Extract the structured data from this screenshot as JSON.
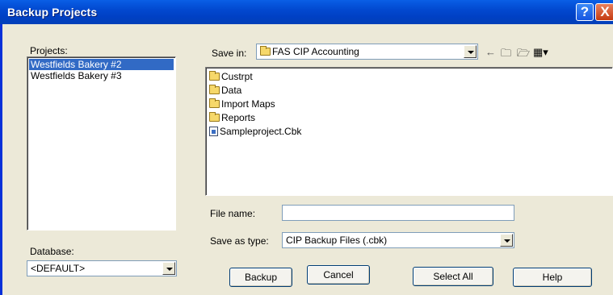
{
  "window": {
    "title": "Backup Projects",
    "help_glyph": "?",
    "close_glyph": "X"
  },
  "projects": {
    "label": "Projects:",
    "items": [
      {
        "label": "Westfields Bakery #2",
        "selected": true
      },
      {
        "label": "Westfields Bakery #3",
        "selected": false
      }
    ]
  },
  "database": {
    "label": "Database:",
    "value": "<DEFAULT>"
  },
  "save_in": {
    "label": "Save in:",
    "value": "FAS CIP Accounting",
    "nav_icons": [
      "back-arrow-icon",
      "up-folder-icon",
      "new-folder-icon",
      "view-menu-icon"
    ]
  },
  "files": [
    {
      "name": "Custrpt",
      "icon": "folder-icon"
    },
    {
      "name": "Data",
      "icon": "folder-icon"
    },
    {
      "name": "Import Maps",
      "icon": "folder-icon"
    },
    {
      "name": "Reports",
      "icon": "folder-icon"
    },
    {
      "name": "Sampleproject.Cbk",
      "icon": "file-icon"
    }
  ],
  "file_name": {
    "label": "File name:",
    "value": ""
  },
  "save_as_type": {
    "label": "Save as type:",
    "value": "CIP Backup Files (.cbk)"
  },
  "buttons": {
    "backup": "Backup",
    "cancel": "Cancel",
    "select_all": "Select All",
    "help": "Help"
  }
}
